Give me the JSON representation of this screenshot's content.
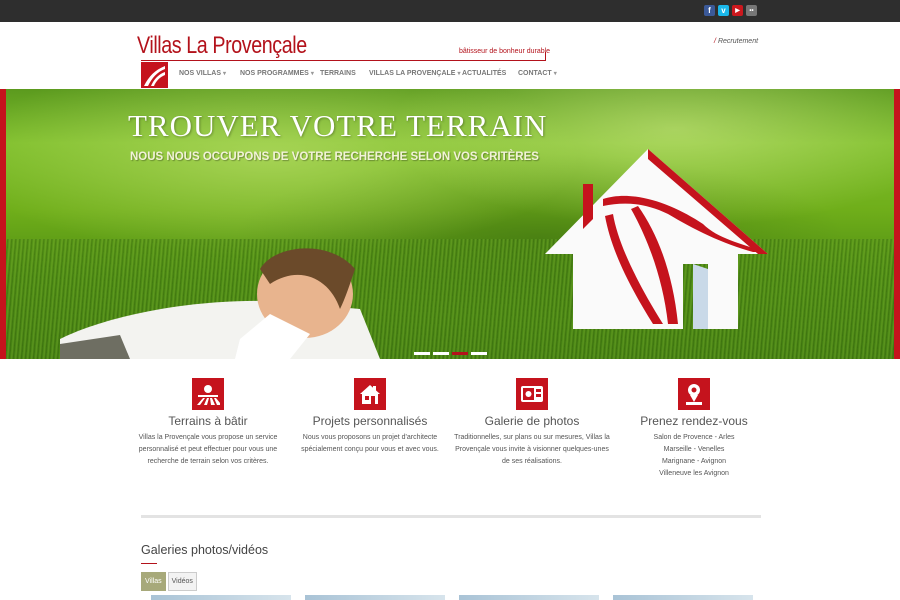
{
  "social": [
    "f",
    "v",
    "▶",
    "••"
  ],
  "social_colors": [
    "#3b5998",
    "#1ab7ea",
    "#cc181e",
    "#777777"
  ],
  "logo": {
    "name": "Villas La Provençale",
    "tagline": "bâtisseur de bonheur durable"
  },
  "recrutement": "Recrutement",
  "nav": [
    {
      "label": "NOS VILLAS",
      "caret": "▾"
    },
    {
      "label": "NOS PROGRAMMES",
      "caret": "▾"
    },
    {
      "label": "TERRAINS",
      "caret": ""
    },
    {
      "label": "VILLAS LA PROVENÇALE",
      "caret": "▾"
    },
    {
      "label": "ACTUALITÉS",
      "caret": ""
    },
    {
      "label": "CONTACT",
      "caret": "▾"
    }
  ],
  "hero": {
    "title": "TROUVER VOTRE TERRAIN",
    "subtitle": "NOUS NOUS OCCUPONS DE VOTRE RECHERCHE SELON VOS CRITÈRES",
    "slides": 4,
    "active_slide": 3
  },
  "features": [
    {
      "icon": "field-icon",
      "title": "Terrains à bâtir",
      "desc": "Villas la Provençale vous propose un service personnalisé et peut effectuer pour vous une recherche de terrain selon vos critères."
    },
    {
      "icon": "house-icon",
      "title": "Projets personnalisés",
      "desc": "Nous vous proposons un projet d'architecte spécialement conçu pour vous et avec vous."
    },
    {
      "icon": "photo-gallery-icon",
      "title": "Galerie de photos",
      "desc": "Traditionnelles, sur plans ou sur mesures, Villas la Provençale vous invite à visionner quelques-unes de ses réalisations."
    },
    {
      "icon": "appointment-icon",
      "title": "Prenez rendez-vous",
      "desc": "Salon de Provence - Arles\nMarseille - Venelles\nMarignane - Avignon\nVilleneuve les Avignon"
    }
  ],
  "gallery": {
    "title": "Galeries photos/vidéos",
    "tabs": [
      "Villas",
      "Vidéos"
    ],
    "active_tab": 0
  },
  "colors": {
    "brand_red": "#c5131d",
    "topbar": "#2e2e2e"
  }
}
